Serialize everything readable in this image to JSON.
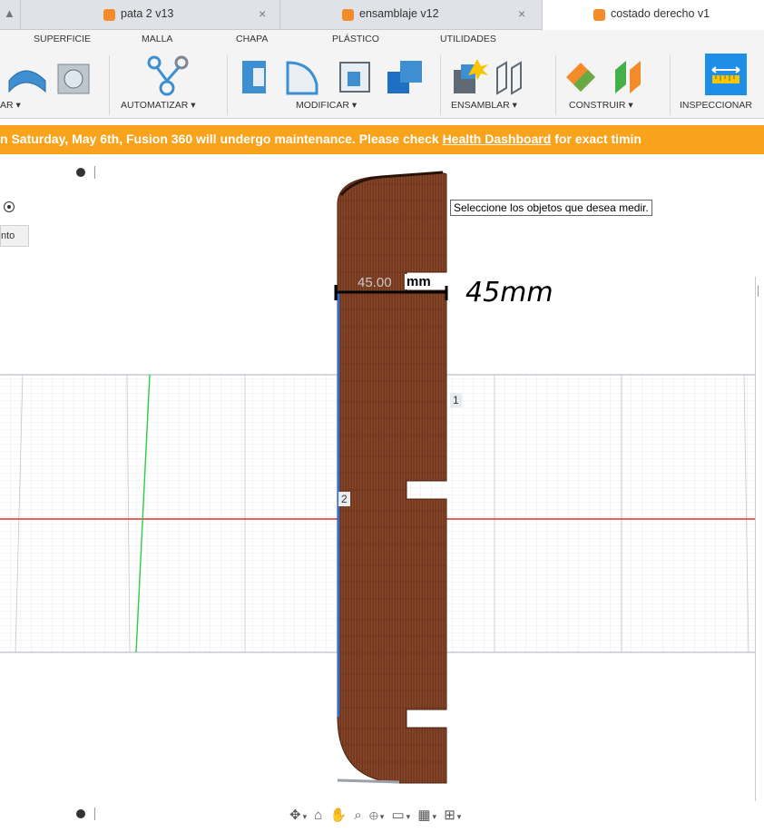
{
  "tabs": [
    {
      "label": "pata 2 v13",
      "active": false
    },
    {
      "label": "ensamblaje v12",
      "active": false
    },
    {
      "label": "costado derecho v1",
      "active": true
    }
  ],
  "ribbon": {
    "tabs": [
      "SUPERFICIE",
      "MALLA",
      "CHAPA",
      "PLÁSTICO",
      "UTILIDADES"
    ],
    "groups": [
      "AR ▾",
      "AUTOMATIZAR ▾",
      "MODIFICAR ▾",
      "ENSAMBLAR ▾",
      "CONSTRUIR ▾",
      "INSPECCIONAR"
    ]
  },
  "banner": {
    "text_before": "n Saturday, May 6th, Fusion 360 will undergo maintenance. Please check ",
    "link": "Health Dashboard",
    "text_after": " for exact timin"
  },
  "left_panel": {
    "label": "nto"
  },
  "tooltip": "Seleccione los objetos que desea medir.",
  "measurement": {
    "value": "45.00",
    "unit": "mm",
    "handwritten": "45mm"
  },
  "markers": {
    "one": "1",
    "two": "2"
  },
  "colors": {
    "accent": "#f9a21b",
    "wood": "#7a3b22",
    "x_axis": "#e03030",
    "y_axis": "#2ecc40",
    "active_edge": "#2d6fd6"
  },
  "nav_icons": [
    "orbit-icon",
    "look-at-icon",
    "pan-icon",
    "zoom-icon",
    "zoom-window-icon",
    "display-settings-icon",
    "grid-settings-icon",
    "viewports-icon"
  ]
}
